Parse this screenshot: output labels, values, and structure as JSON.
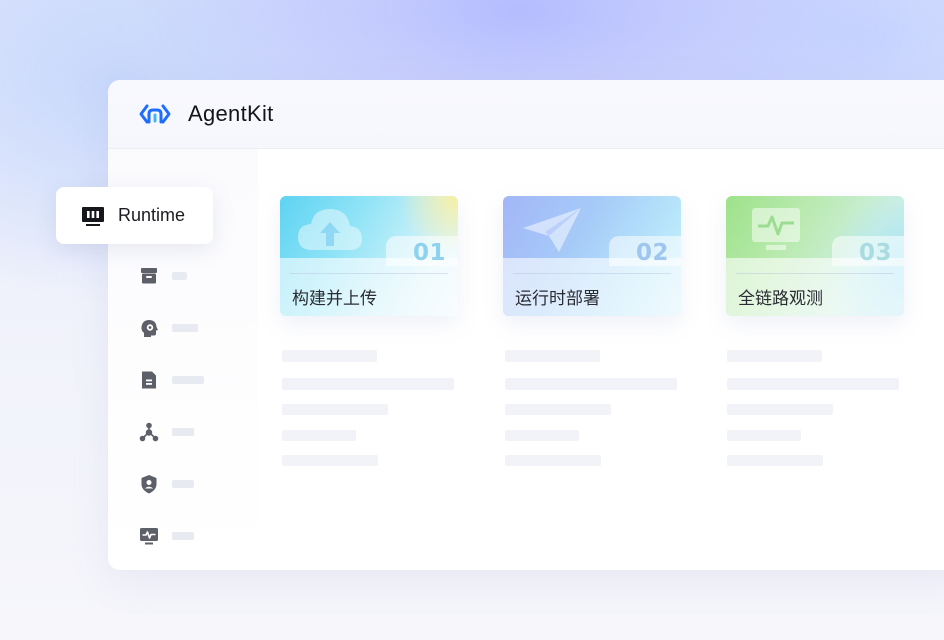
{
  "app": {
    "title": "AgentKit"
  },
  "runtime_chip": {
    "label": "Runtime",
    "icon": "runtime-icon"
  },
  "rail": {
    "items": [
      {
        "icon": "archive-icon"
      },
      {
        "icon": "agent-head-icon"
      },
      {
        "icon": "document-icon"
      },
      {
        "icon": "network-icon"
      },
      {
        "icon": "shield-user-icon"
      },
      {
        "icon": "monitor-pulse-icon"
      }
    ]
  },
  "cards": [
    {
      "number": "01",
      "title": "构建并上传",
      "icon": "cloud-upload-icon"
    },
    {
      "number": "02",
      "title": "运行时部署",
      "icon": "paper-plane-icon"
    },
    {
      "number": "03",
      "title": "全链路观测",
      "icon": "monitor-pulse-icon"
    }
  ],
  "colors": {
    "logo_blue": "#1f6dff",
    "text_dark": "#14151a",
    "rail_icon": "#5d6069",
    "skeleton": "#f1f3f8"
  }
}
